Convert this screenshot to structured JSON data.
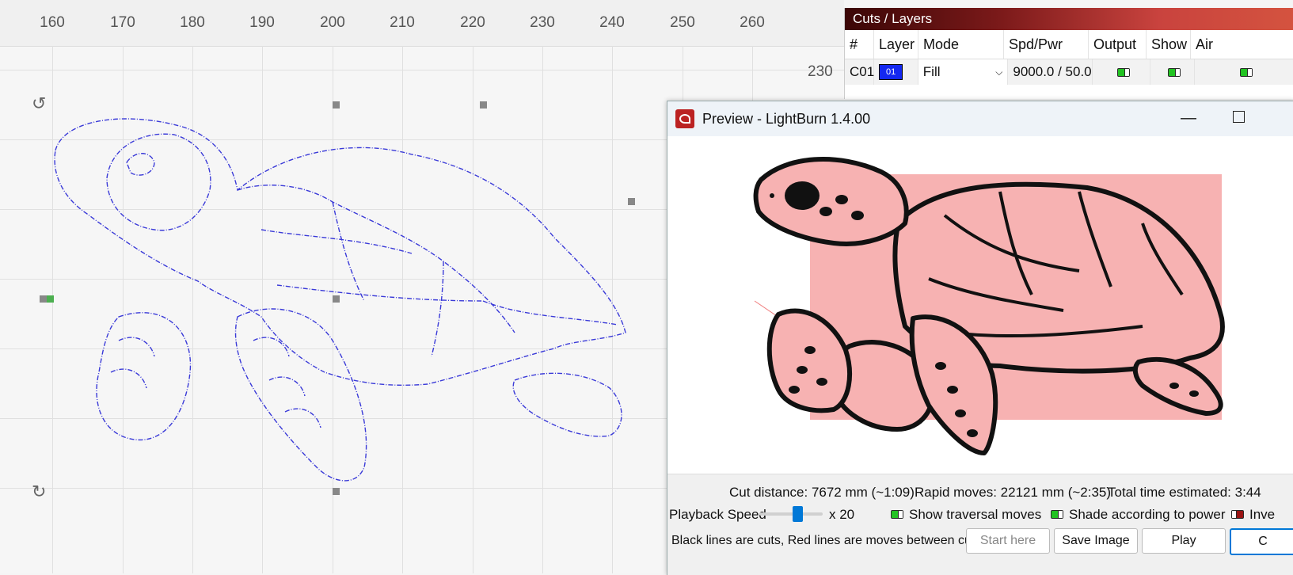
{
  "ruler_ticks": [
    "160",
    "170",
    "180",
    "190",
    "200",
    "210",
    "220",
    "230",
    "240",
    "250",
    "260"
  ],
  "y_ruler_label": "230",
  "cuts": {
    "title": "Cuts / Layers",
    "headers": [
      "#",
      "Layer",
      "Mode",
      "Spd/Pwr",
      "Output",
      "Show",
      "Air"
    ],
    "row": {
      "id": "C01",
      "layer": "01",
      "layer_color": "#1428f0",
      "mode": "Fill",
      "spd_pwr": "9000.0 / 50.0"
    }
  },
  "preview": {
    "title": "Preview - LightBurn 1.4.00",
    "cut_distance": "Cut distance: 7672 mm (~1:09)",
    "rapid_moves": "Rapid moves: 22121 mm (~2:35)",
    "total_time": "Total time estimated: 3:44",
    "playback_label": "Playback Speed",
    "playback_value": 0.6,
    "playback_mult": "x 20",
    "show_traversal": "Show traversal moves",
    "shade_power": "Shade according to power",
    "invert": "Inve",
    "legend": "Black lines are cuts, Red lines are moves between cuts",
    "btn_start": "Start here",
    "btn_save": "Save Image",
    "btn_play": "Play",
    "btn_close": "C"
  },
  "colors": {
    "outline": "#3a3ad8",
    "fill": "#f7b2b2",
    "accent": "#0078d7"
  }
}
